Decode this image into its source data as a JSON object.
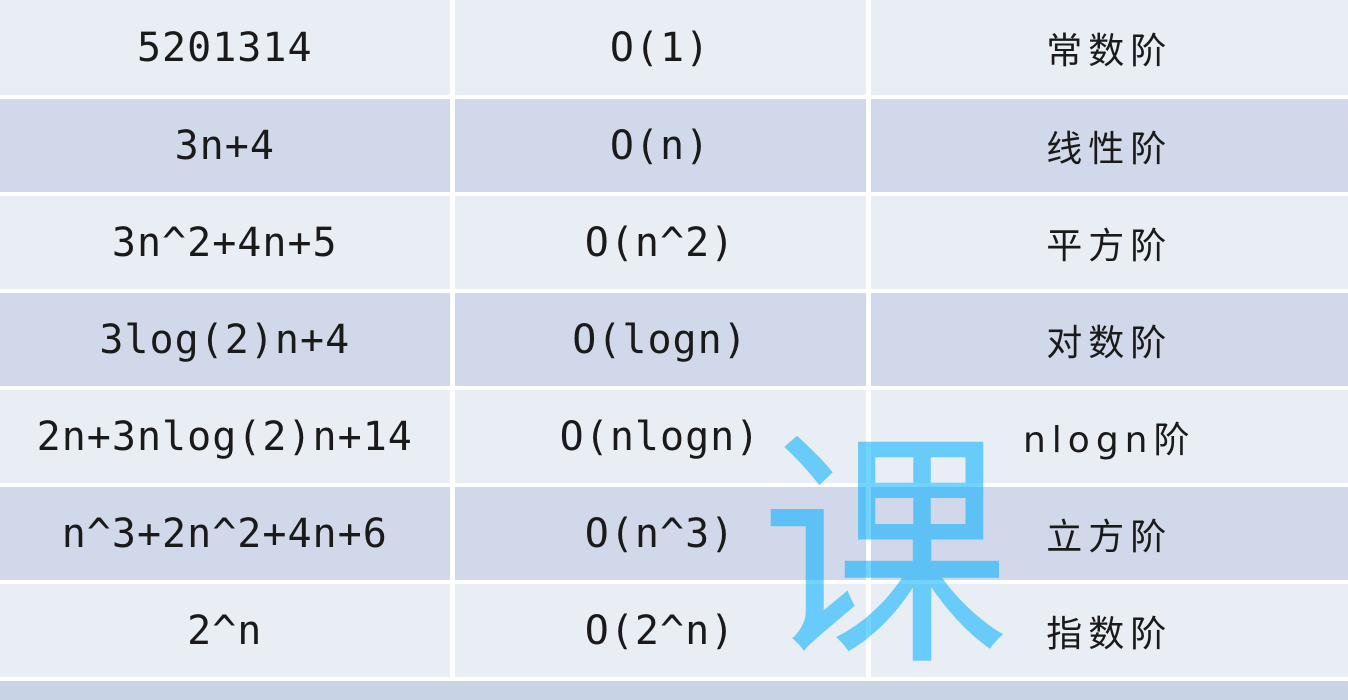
{
  "table": {
    "rows": [
      {
        "expr": "5201314",
        "bigo": "O(1)",
        "name": "常数阶"
      },
      {
        "expr": "3n+4",
        "bigo": "O(n)",
        "name": "线性阶"
      },
      {
        "expr": "3n^2+4n+5",
        "bigo": "O(n^2)",
        "name": "平方阶"
      },
      {
        "expr": "3log(2)n+4",
        "bigo": "O(logn)",
        "name": "对数阶"
      },
      {
        "expr": "2n+3nlog(2)n+14",
        "bigo": "O(nlogn)",
        "name": "nlogn阶"
      },
      {
        "expr": "n^3+2n^2+4n+6",
        "bigo": "O(n^3)",
        "name": "立方阶"
      },
      {
        "expr": "2^n",
        "bigo": "O(2^n)",
        "name": "指数阶"
      }
    ]
  },
  "watermark": {
    "text": "课",
    "color": "#00aeff"
  }
}
